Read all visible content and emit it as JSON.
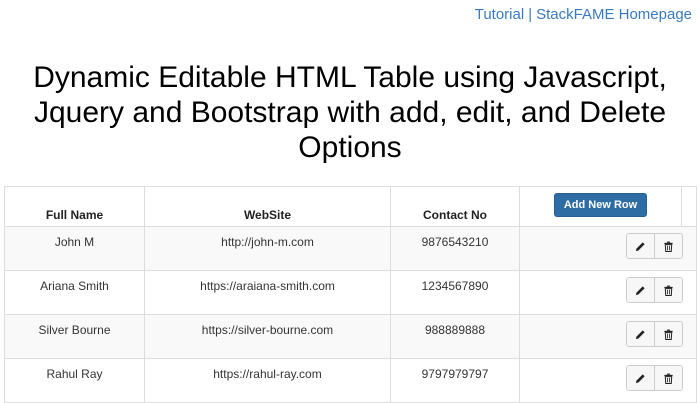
{
  "header": {
    "links": [
      "Tutorial",
      "StackFAME Homepage"
    ],
    "separator": "|"
  },
  "title": "Dynamic Editable HTML Table using Javascript, Jquery and Bootstrap with add, edit, and Delete Options",
  "table": {
    "columns": [
      "Full Name",
      "WebSite",
      "Contact No"
    ],
    "add_button_label": "Add New Row",
    "rows": [
      {
        "name": "John M",
        "website": "http://john-m.com",
        "contact": "9876543210"
      },
      {
        "name": "Ariana Smith",
        "website": "https://araiana-smith.com",
        "contact": "1234567890"
      },
      {
        "name": "Silver Bourne",
        "website": "https://silver-bourne.com",
        "contact": "988889888"
      },
      {
        "name": "Rahul Ray",
        "website": "https://rahul-ray.com",
        "contact": "9797979797"
      }
    ],
    "row_action_icons": [
      "pencil-icon",
      "trash-icon"
    ]
  },
  "colors": {
    "link": "#3a7bbf",
    "primary_button": "#2e6da4",
    "border": "#dddddd",
    "stripe": "#f9f9f9"
  }
}
